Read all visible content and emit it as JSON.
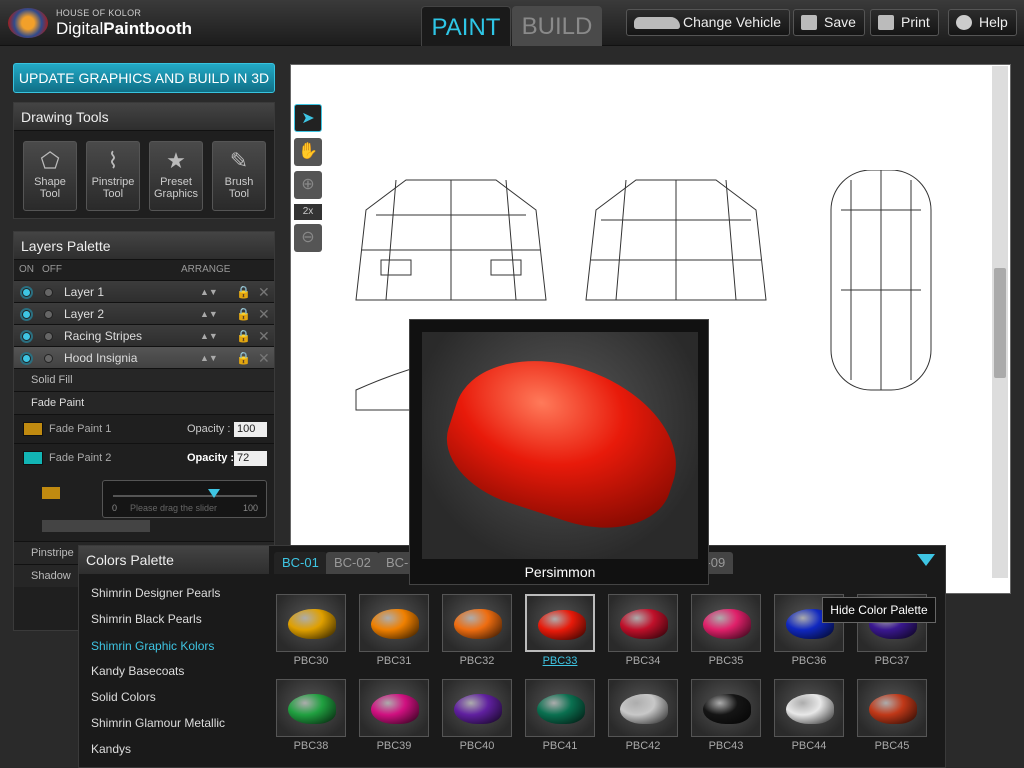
{
  "app": {
    "brand_small": "HOUSE OF KOLOR",
    "brand_light": "Digital",
    "brand_bold": "Paintbooth"
  },
  "modes": {
    "paint": "PAINT",
    "build": "BUILD"
  },
  "toolbar": {
    "change_vehicle": "Change Vehicle",
    "save": "Save",
    "print": "Print",
    "help": "Help"
  },
  "update_button": "UPDATE GRAPHICS AND BUILD IN 3D",
  "drawing_tools": {
    "title": "Drawing Tools",
    "tools": [
      {
        "line1": "Shape",
        "line2": "Tool",
        "icon": "shape-icon"
      },
      {
        "line1": "Pinstripe",
        "line2": "Tool",
        "icon": "pinstripe-icon"
      },
      {
        "line1": "Preset",
        "line2": "Graphics",
        "icon": "star-icon"
      },
      {
        "line1": "Brush",
        "line2": "Tool",
        "icon": "brush-icon"
      }
    ]
  },
  "layers": {
    "title": "Layers Palette",
    "col_on": "ON",
    "col_off": "OFF",
    "col_arrange": "ARRANGE",
    "rows": [
      "Layer 1",
      "Layer 2",
      "Racing Stripes",
      "Hood Insignia"
    ],
    "solid_fill": "Solid Fill",
    "fade_paint": "Fade Paint",
    "fade1": "Fade Paint 1",
    "fade1_opacity": "100",
    "fade2": "Fade Paint 2",
    "fade2_opacity": "72",
    "opacity_label": "Opacity :",
    "slider_min": "0",
    "slider_max": "100",
    "slider_hint": "Please drag the slider",
    "pinstripe": "Pinstripe",
    "shadow": "Shadow",
    "fade1_color": "#c08a10",
    "fade2_color": "#12b5b5"
  },
  "canvas": {
    "zoom_label": "2x"
  },
  "preview": {
    "name": "Persimmon"
  },
  "colors": {
    "title": "Colors Palette",
    "tabs": [
      "BC-01",
      "BC-02",
      "BC-0",
      "C-09"
    ],
    "categories": [
      "Shimrin Designer Pearls",
      "Shimrin Black Pearls",
      "Shimrin Graphic Kolors",
      "Kandy Basecoats",
      "Solid Colors",
      "Shimrin Glamour Metallic",
      "Kandys"
    ],
    "swatches": [
      {
        "code": "PBC30",
        "color": "#e0a000"
      },
      {
        "code": "PBC31",
        "color": "#f08000"
      },
      {
        "code": "PBC32",
        "color": "#ef6d10"
      },
      {
        "code": "PBC33",
        "color": "#e81a0a"
      },
      {
        "code": "PBC34",
        "color": "#c0102a"
      },
      {
        "code": "PBC35",
        "color": "#e0206a"
      },
      {
        "code": "PBC36",
        "color": "#1028c0"
      },
      {
        "code": "PBC37",
        "color": "#3a1890"
      },
      {
        "code": "PBC38",
        "color": "#20a040"
      },
      {
        "code": "PBC39",
        "color": "#d01080"
      },
      {
        "code": "PBC40",
        "color": "#6020a0"
      },
      {
        "code": "PBC41",
        "color": "#0a7050"
      },
      {
        "code": "PBC42",
        "color": "#c8c8c8"
      },
      {
        "code": "PBC43",
        "color": "#151515"
      },
      {
        "code": "PBC44",
        "color": "#e8e8e8"
      },
      {
        "code": "PBC45",
        "color": "#c03818"
      }
    ],
    "tooltip": "Hide Color Palette"
  },
  "accent": "#3ec5e3"
}
